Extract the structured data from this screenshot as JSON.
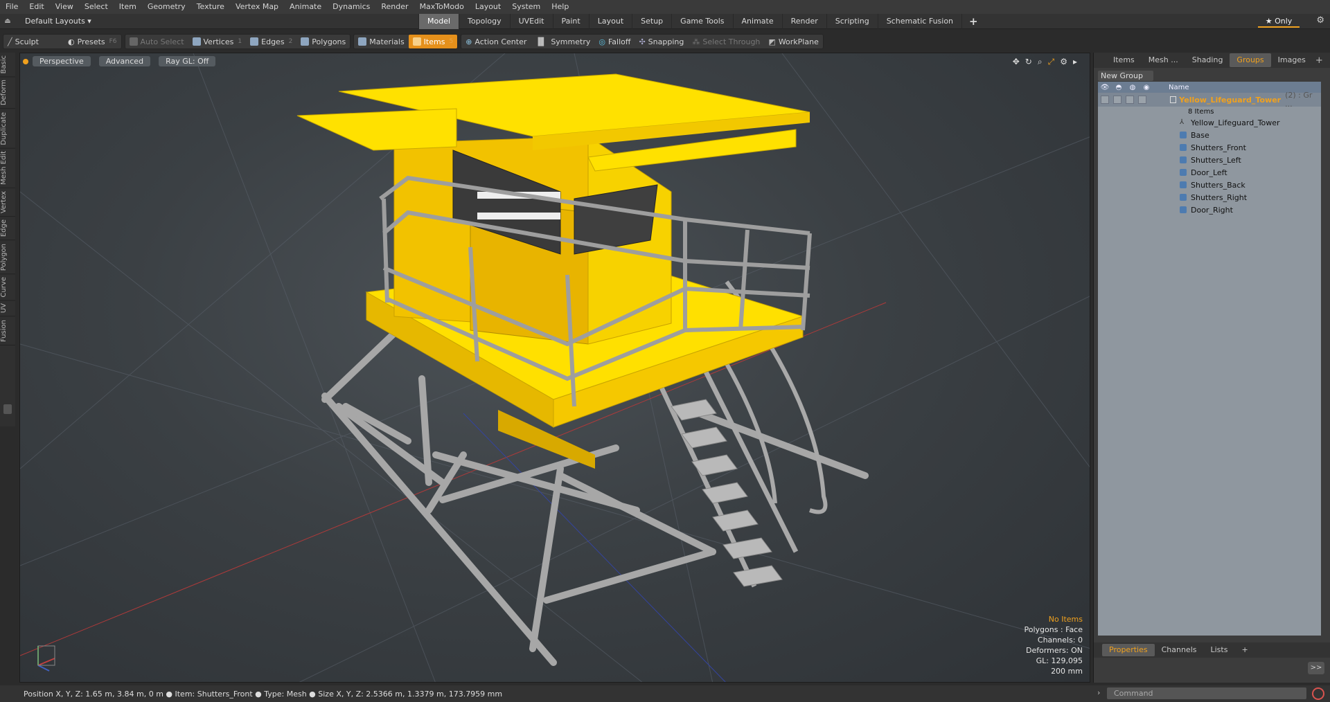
{
  "menu": [
    "File",
    "Edit",
    "View",
    "Select",
    "Item",
    "Geometry",
    "Texture",
    "Vertex Map",
    "Animate",
    "Dynamics",
    "Render",
    "MaxToModo",
    "Layout",
    "System",
    "Help"
  ],
  "layout": {
    "selector": "Default Layouts ▾"
  },
  "tabs": [
    "Model",
    "Topology",
    "UVEdit",
    "Paint",
    "Layout",
    "Setup",
    "Game Tools",
    "Animate",
    "Render",
    "Scripting",
    "Schematic Fusion",
    "+"
  ],
  "only_label": "★  Only",
  "toolbar": {
    "sculpt": "Sculpt",
    "presets": "Presets",
    "presets_key": "F6",
    "auto_select": "Auto Select",
    "vertices": "Vertices",
    "vertices_key": "1",
    "edges": "Edges",
    "edges_key": "2",
    "polygons": "Polygons",
    "materials": "Materials",
    "items": "Items",
    "items_key": "5",
    "action_center": "Action Center",
    "symmetry": "Symmetry",
    "falloff": "Falloff",
    "snapping": "Snapping",
    "select_through": "Select Through",
    "workplane": "WorkPlane"
  },
  "left_tabs": [
    "Basic",
    "Deform",
    "Duplicate",
    "Mesh Edit",
    "Vertex",
    "Edge",
    "Polygon",
    "Curve",
    "UV",
    "Fusion"
  ],
  "viewport": {
    "view_mode": "Perspective",
    "advanced": "Advanced",
    "raygl": "Ray GL: Off",
    "stats": {
      "no_items": "No Items",
      "polygons": "Polygons : Face",
      "channels": "Channels: 0",
      "deformers": "Deformers: ON",
      "gl": "GL: 129,095",
      "scale": "200 mm"
    }
  },
  "right_panel": {
    "tabs": [
      "Items",
      "Mesh ...",
      "Shading",
      "Groups",
      "Images",
      "+"
    ],
    "new_group": "New Group",
    "name_header": "Name",
    "group": {
      "name": "Yellow_Lifeguard_Tower",
      "suffix": "(2) : Gr ...",
      "count": "8 Items"
    },
    "items": [
      "Yellow_Lifeguard_Tower",
      "Base",
      "Shutters_Front",
      "Shutters_Left",
      "Door_Left",
      "Shutters_Back",
      "Shutters_Right",
      "Door_Right"
    ],
    "bottom_tabs": [
      "Properties",
      "Channels",
      "Lists",
      "+"
    ],
    "expand": ">>"
  },
  "status": {
    "text": "Position X, Y, Z:   1.65 m, 3.84 m, 0 m  ●  Item:  Shutters_Front  ●  Type:  Mesh  ●  Size X, Y, Z:   2.5366 m, 1.3379 m, 173.7959 mm",
    "command_placeholder": "Command"
  },
  "colors": {
    "accent": "#f0a11e",
    "tower_yellow": "#ffd400",
    "rail_gray": "#9a9a9a"
  }
}
